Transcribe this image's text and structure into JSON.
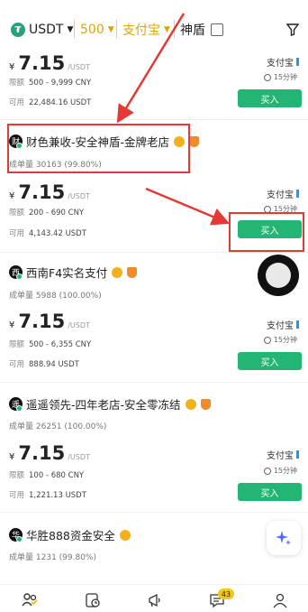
{
  "topbar": {
    "currency": "USDT",
    "amount": "500",
    "payment": "支付宝",
    "shield_label": "神盾"
  },
  "cards": [
    {
      "price_currency": "¥",
      "price": "7.15",
      "price_unit": "/USDT",
      "limit_label": "限额",
      "limit_value": "500 - 9,999 CNY",
      "avail_label": "可用",
      "avail_value": "22,484.16 USDT",
      "payment": "支付宝",
      "time": "15分钟",
      "buy_label": "买入"
    },
    {
      "merchant_initial": "财",
      "merchant_name": "财色兼收-安全神盾-金牌老店",
      "stats_label": "成单量",
      "stats_value": "30163 (99.80%)",
      "price_currency": "¥",
      "price": "7.15",
      "price_unit": "/USDT",
      "limit_label": "限额",
      "limit_value": "200 - 690 CNY",
      "avail_label": "可用",
      "avail_value": "4,143.42 USDT",
      "payment": "支付宝",
      "time": "15分钟",
      "buy_label": "买入"
    },
    {
      "merchant_initial": "西",
      "merchant_name": "西南F4实名支付",
      "stats_label": "成单量",
      "stats_value": "5988 (100.00%)",
      "price_currency": "¥",
      "price": "7.15",
      "price_unit": "/USDT",
      "limit_label": "限额",
      "limit_value": "500 - 6,355 CNY",
      "avail_label": "可用",
      "avail_value": "888.94 USDT",
      "payment": "支付宝",
      "time": "15分钟",
      "buy_label": "买入"
    },
    {
      "merchant_initial": "遥",
      "merchant_name": "遥遥领先-四年老店-安全零冻结",
      "stats_label": "成单量",
      "stats_value": "26251 (100.00%)",
      "price_currency": "¥",
      "price": "7.15",
      "price_unit": "/USDT",
      "limit_label": "限额",
      "limit_value": "100 - 680 CNY",
      "avail_label": "可用",
      "avail_value": "1,221.13 USDT",
      "payment": "支付宝",
      "time": "15分钟",
      "buy_label": "买入"
    },
    {
      "merchant_initial": "华",
      "merchant_name": "华胜888资金安全",
      "stats_label": "成单量",
      "stats_value": "1231 (99.80%)"
    }
  ],
  "bottom_nav": {
    "messages_badge": "43"
  },
  "colors": {
    "buy_green": "#22b573",
    "highlight_red": "#e53935",
    "accent_yellow": "#e0a400"
  }
}
